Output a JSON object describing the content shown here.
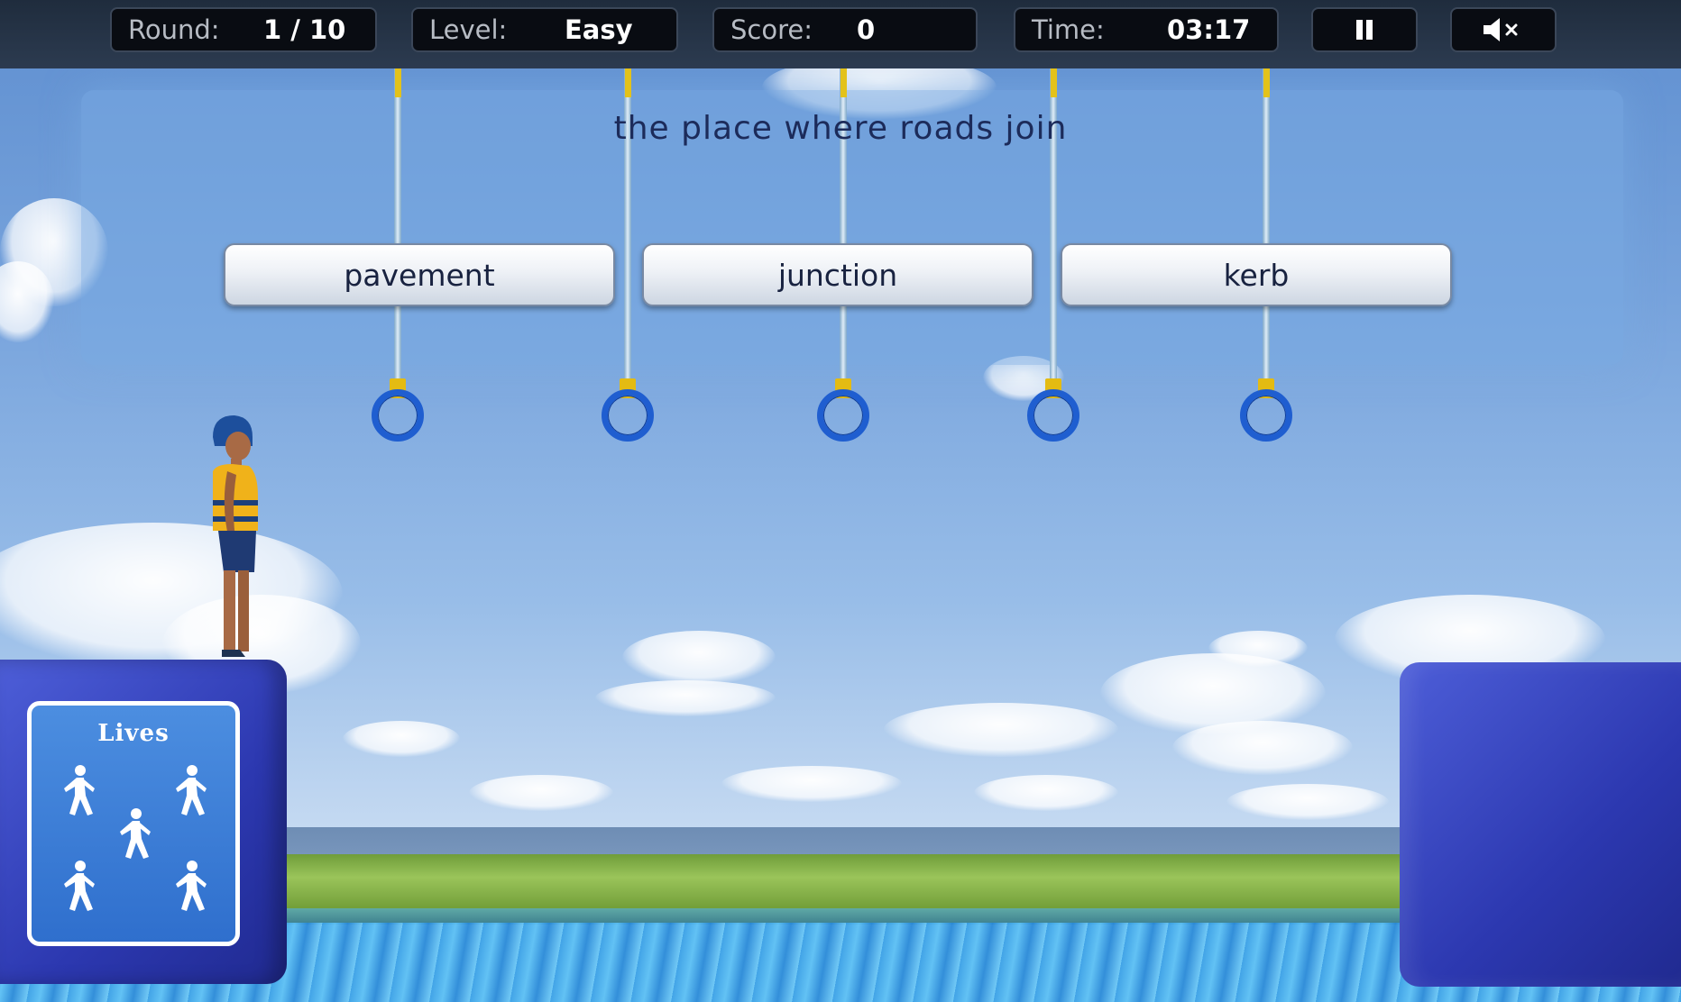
{
  "hud": {
    "round_label": "Round:",
    "round_value": "1 / 10",
    "level_label": "Level:",
    "level_value": "Easy",
    "score_label": "Score:",
    "score_value": "0",
    "time_label": "Time:",
    "time_value": "03:17",
    "pause_icon": "pause-icon",
    "mute_icon": "speaker-muted-icon"
  },
  "question": {
    "text": "the place where roads join"
  },
  "answers": [
    {
      "label": "pavement"
    },
    {
      "label": "junction"
    },
    {
      "label": "kerb"
    }
  ],
  "lives": {
    "title": "Lives",
    "count": 5,
    "icon": "running-person-icon"
  },
  "rings": {
    "count": 5,
    "icon": "ring-icon"
  },
  "colors": {
    "hud_bg": "#090c12",
    "platform_blue": "#2c38b0",
    "ring_blue": "#1f5ed0",
    "rope_yellow": "#e3c21a",
    "question_text": "#1c2b5a"
  }
}
